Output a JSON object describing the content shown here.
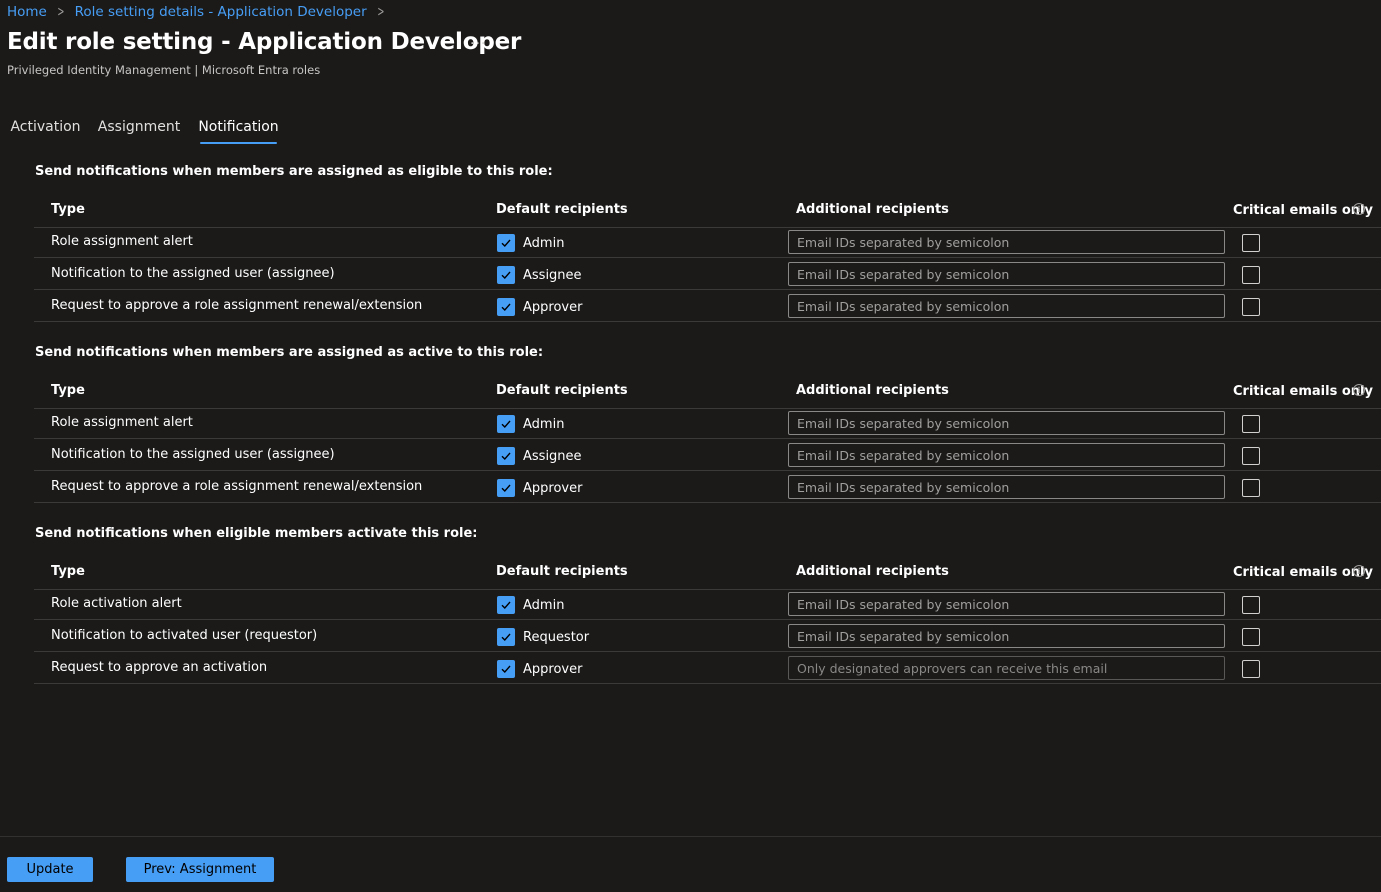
{
  "breadcrumb": {
    "items": [
      "Home",
      "Role setting details - Application Developer"
    ]
  },
  "header": {
    "title": "Edit role setting - Application Developer",
    "more_icon": "more-horizontal-icon",
    "subtitle": "Privileged Identity Management | Microsoft Entra roles"
  },
  "tabs": [
    {
      "label": "Activation",
      "active": false
    },
    {
      "label": "Assignment",
      "active": false
    },
    {
      "label": "Notification",
      "active": true
    }
  ],
  "columns": {
    "type": "Type",
    "default": "Default recipients",
    "additional": "Additional recipients",
    "critical": "Critical emails only",
    "info_icon": "info-icon"
  },
  "sections": [
    {
      "title": "Send notifications when members are assigned as eligible to this role:",
      "rows": [
        {
          "type": "Role assignment alert",
          "recipient": "Admin",
          "checked": true,
          "placeholder": "Email IDs separated by semicolon",
          "disabled": false,
          "critical": false
        },
        {
          "type": "Notification to the assigned user (assignee)",
          "recipient": "Assignee",
          "checked": true,
          "placeholder": "Email IDs separated by semicolon",
          "disabled": false,
          "critical": false
        },
        {
          "type": "Request to approve a role assignment renewal/extension",
          "recipient": "Approver",
          "checked": true,
          "placeholder": "Email IDs separated by semicolon",
          "disabled": false,
          "critical": false
        }
      ]
    },
    {
      "title": "Send notifications when members are assigned as active to this role:",
      "rows": [
        {
          "type": "Role assignment alert",
          "recipient": "Admin",
          "checked": true,
          "placeholder": "Email IDs separated by semicolon",
          "disabled": false,
          "critical": false
        },
        {
          "type": "Notification to the assigned user (assignee)",
          "recipient": "Assignee",
          "checked": true,
          "placeholder": "Email IDs separated by semicolon",
          "disabled": false,
          "critical": false
        },
        {
          "type": "Request to approve a role assignment renewal/extension",
          "recipient": "Approver",
          "checked": true,
          "placeholder": "Email IDs separated by semicolon",
          "disabled": false,
          "critical": false
        }
      ]
    },
    {
      "title": "Send notifications when eligible members activate this role:",
      "rows": [
        {
          "type": "Role activation alert",
          "recipient": "Admin",
          "checked": true,
          "placeholder": "Email IDs separated by semicolon",
          "disabled": false,
          "critical": false
        },
        {
          "type": "Notification to activated user (requestor)",
          "recipient": "Requestor",
          "checked": true,
          "placeholder": "Email IDs separated by semicolon",
          "disabled": false,
          "critical": false
        },
        {
          "type": "Request to approve an activation",
          "recipient": "Approver",
          "checked": true,
          "placeholder": "Only designated approvers can receive this email",
          "disabled": true,
          "critical": false
        }
      ]
    }
  ],
  "footer": {
    "update_label": "Update",
    "prev_label": "Prev: Assignment"
  },
  "colors": {
    "accent": "#479ef5",
    "background": "#1b1a19",
    "divider": "#3b3a39"
  }
}
